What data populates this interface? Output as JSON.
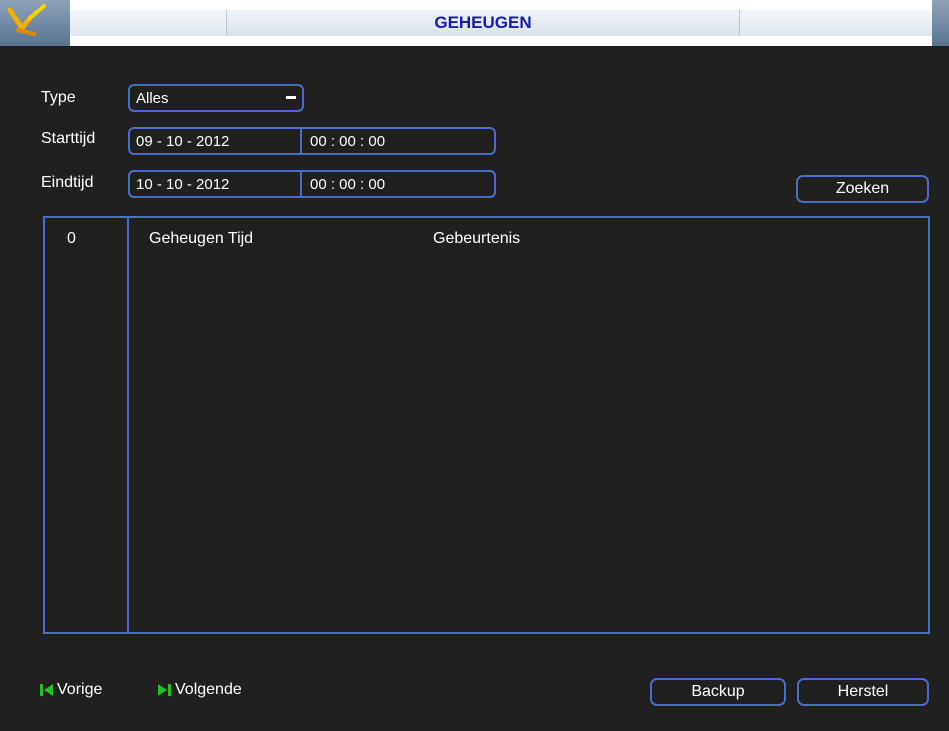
{
  "window": {
    "title": "GEHEUGEN"
  },
  "filters": {
    "type_label": "Type",
    "type_value": "Alles",
    "start_label": "Starttijd",
    "start_date": "09 - 10 - 2012",
    "start_time": "00 : 00 : 00",
    "end_label": "Eindtijd",
    "end_date": "10 - 10 - 2012",
    "end_time": "00 : 00 : 00",
    "search_label": "Zoeken"
  },
  "list": {
    "count": "0",
    "columns": [
      "Geheugen Tijd",
      "Gebeurtenis"
    ],
    "rows": []
  },
  "footer": {
    "prev_label": "Vorige",
    "next_label": "Volgende",
    "backup_label": "Backup",
    "restore_label": "Herstel"
  },
  "colors": {
    "accent": "#4d6cc9",
    "background": "#202020",
    "title_text": "#1a1ab0",
    "nav_icon": "#22c022"
  },
  "icons": {
    "logo": "tools-logo-icon",
    "dropdown": "dropdown-arrow-icon",
    "prev": "skip-previous-icon",
    "next": "skip-next-icon"
  }
}
